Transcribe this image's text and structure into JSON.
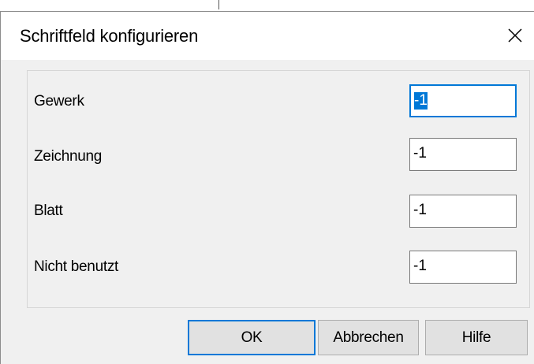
{
  "window": {
    "title": "Schriftfeld konfigurieren",
    "close_icon": "close-icon"
  },
  "fields": [
    {
      "label": "Gewerk",
      "value": "-1",
      "focused": true
    },
    {
      "label": "Zeichnung",
      "value": "-1",
      "focused": false
    },
    {
      "label": "Blatt",
      "value": "-1",
      "focused": false
    },
    {
      "label": "Nicht benutzt",
      "value": "-1",
      "focused": false
    }
  ],
  "buttons": {
    "ok_label": "OK",
    "cancel_label": "Abbrechen",
    "help_label": "Hilfe"
  },
  "colors": {
    "accent": "#0078d7",
    "dialog_bg": "#f0f0f0",
    "button_bg": "#e1e1e1"
  }
}
